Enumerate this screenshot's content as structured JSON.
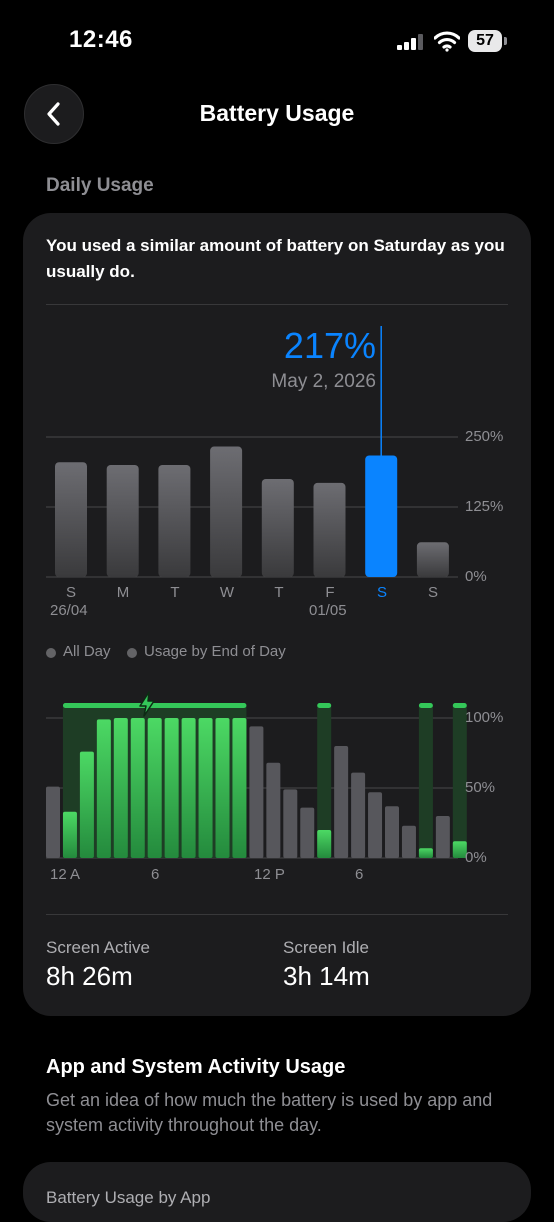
{
  "status": {
    "time": "12:46",
    "battery_level": "57"
  },
  "nav": {
    "title": "Battery Usage"
  },
  "daily": {
    "section_label": "Daily Usage",
    "insight": "You used a similar amount of battery on Saturday as you usually do.",
    "selected_value": "217%",
    "selected_date": "May 2, 2026",
    "y_ticks": [
      "250%",
      "125%",
      "0%"
    ],
    "days": [
      {
        "label": "S",
        "sub": "26/04",
        "value": 205,
        "selected": false
      },
      {
        "label": "M",
        "sub": "",
        "value": 200,
        "selected": false
      },
      {
        "label": "T",
        "sub": "",
        "value": 200,
        "selected": false
      },
      {
        "label": "W",
        "sub": "",
        "value": 233,
        "selected": false
      },
      {
        "label": "T",
        "sub": "",
        "value": 175,
        "selected": false
      },
      {
        "label": "F",
        "sub": "01/05",
        "value": 168,
        "selected": false
      },
      {
        "label": "S",
        "sub": "",
        "value": 217,
        "selected": true
      },
      {
        "label": "S",
        "sub": "",
        "value": 62,
        "selected": false
      }
    ]
  },
  "hourly": {
    "legend": [
      "All Day",
      "Usage by End of Day"
    ],
    "y_ticks": [
      "100%",
      "50%",
      "0%"
    ],
    "x_ticks": [
      "12 A",
      "6",
      "12 P",
      "6"
    ],
    "levels": [
      {
        "hour": 0,
        "level": 51,
        "charging": false
      },
      {
        "hour": 1,
        "level": 33,
        "charging": true
      },
      {
        "hour": 2,
        "level": 76,
        "charging": true
      },
      {
        "hour": 3,
        "level": 99,
        "charging": true
      },
      {
        "hour": 4,
        "level": 100,
        "charging": true
      },
      {
        "hour": 5,
        "level": 100,
        "charging": true
      },
      {
        "hour": 6,
        "level": 100,
        "charging": true
      },
      {
        "hour": 7,
        "level": 100,
        "charging": true
      },
      {
        "hour": 8,
        "level": 100,
        "charging": true
      },
      {
        "hour": 9,
        "level": 100,
        "charging": true
      },
      {
        "hour": 10,
        "level": 100,
        "charging": true
      },
      {
        "hour": 11,
        "level": 100,
        "charging": true
      },
      {
        "hour": 12,
        "level": 94,
        "charging": false
      },
      {
        "hour": 13,
        "level": 68,
        "charging": false
      },
      {
        "hour": 14,
        "level": 49,
        "charging": false
      },
      {
        "hour": 15,
        "level": 36,
        "charging": false
      },
      {
        "hour": 16,
        "level": 20,
        "charging": true
      },
      {
        "hour": 17,
        "level": 80,
        "charging": false
      },
      {
        "hour": 18,
        "level": 61,
        "charging": false
      },
      {
        "hour": 19,
        "level": 47,
        "charging": false
      },
      {
        "hour": 20,
        "level": 37,
        "charging": false
      },
      {
        "hour": 21,
        "level": 23,
        "charging": false
      },
      {
        "hour": 22,
        "level": 7,
        "charging": true
      },
      {
        "hour": 23,
        "level": 30,
        "charging": false
      },
      {
        "hour": 24,
        "level": 12,
        "charging": true
      }
    ]
  },
  "stats": [
    {
      "label": "Screen Active",
      "value": "8h 26m"
    },
    {
      "label": "Screen Idle",
      "value": "3h 14m"
    }
  ],
  "activity": {
    "title": "App and System Activity Usage",
    "description": "Get an idea of how much the battery is used by app and system activity throughout the day."
  },
  "by_app": {
    "title": "Battery Usage by App"
  },
  "colors": {
    "accent": "#0a84ff",
    "bar_gray": "#636366",
    "charge_green": "#34c759",
    "card": "#1c1c1e"
  }
}
